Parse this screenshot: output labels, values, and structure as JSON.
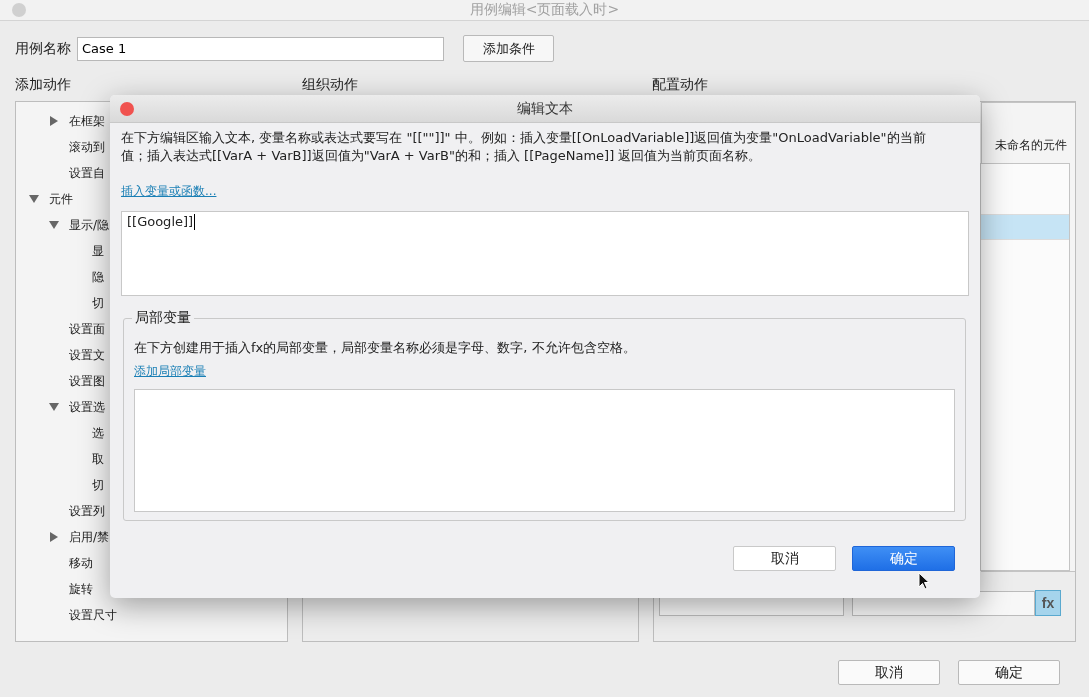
{
  "window": {
    "title": "用例编辑<页面载入时>"
  },
  "case_name": {
    "label": "用例名称",
    "value": "Case 1"
  },
  "add_condition_button": "添加条件",
  "headings": [
    "添加动作",
    "组织动作",
    "配置动作"
  ],
  "tree": [
    {
      "children": [
        {
          "label": "在框架",
          "expanded": false
        },
        {
          "label": "滚动到"
        },
        {
          "label": "设置自"
        }
      ]
    },
    {
      "label": "元件",
      "expanded": true,
      "children": [
        {
          "label": "显示/隐",
          "expanded": true,
          "children": [
            {
              "label": "显"
            },
            {
              "label": "隐"
            },
            {
              "label": "切"
            }
          ]
        },
        {
          "label": "设置面"
        },
        {
          "label": "设置文"
        },
        {
          "label": "设置图"
        },
        {
          "label": "设置选",
          "expanded": true,
          "children": [
            {
              "label": "选"
            },
            {
              "label": "取"
            },
            {
              "label": "切"
            }
          ]
        },
        {
          "label": "设置列"
        },
        {
          "label": "启用/禁",
          "expanded": false
        },
        {
          "label": "移动"
        },
        {
          "label": "旋转"
        },
        {
          "label": "设置尺寸"
        }
      ]
    }
  ],
  "config": {
    "target_label": "未命名的元件",
    "list_rows": [
      {
        "selected": false
      },
      {
        "selected": true
      }
    ],
    "fx_button": "fx"
  },
  "footer_buttons": [
    {
      "label": "取消"
    },
    {
      "label": "确定"
    }
  ],
  "dialog": {
    "title": "编辑文本",
    "description": "在下方编辑区输入文本, 变量名称或表达式要写在 \"[[\"\"]]\" 中。例如：插入变量[[OnLoadVariable]]返回值为变量\"OnLoadVariable\"的当前值；插入表达式[[VarA + VarB]]返回值为\"VarA + VarB\"的和；插入 [[PageName]] 返回值为当前页面名称。",
    "insert_link": "插入变量或函数...",
    "text_value": "[[Google]]",
    "local_vars": {
      "legend": "局部变量",
      "description": "在下方创建用于插入fx的局部变量，局部变量名称必须是字母、数字, 不允许包含空格。",
      "add_link": "添加局部变量"
    },
    "buttons": [
      {
        "label": "取消",
        "primary": false
      },
      {
        "label": "确定",
        "primary": true
      }
    ]
  }
}
